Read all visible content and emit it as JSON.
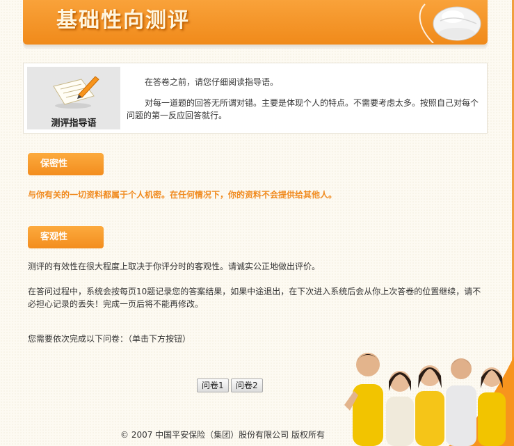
{
  "banner": {
    "title": "基础性向测评"
  },
  "guide": {
    "thumb_label": "测评指导语",
    "p1": "在答卷之前，请您仔细阅读指导语。",
    "p2": "对每一道题的回答无所谓对错。主要是体现个人的特点。不需要考虑太多。按照自己对每个问题的第一反应回答就行。"
  },
  "confidentiality": {
    "title": "保密性",
    "text": "与你有关的一切资料都属于个人机密。在任何情况下，你的资料不会提供给其他人。"
  },
  "objectivity": {
    "title": "客观性",
    "text1": "测评的有效性在很大程度上取决于你评分时的客观性。请诚实公正地做出评价。",
    "text2": "在答问过程中，系统会按每页10题记录您的答案结果，如果中途退出，在下次进入系统后会从你上次答卷的位置继续，请不必担心记录的丢失！完成一页后将不能再修改。",
    "text3": "您需要依次完成以下问卷：（单击下方按钮）"
  },
  "buttons": {
    "survey1": "问卷1",
    "survey2": "问卷2"
  },
  "footer": {
    "copyright": "© 2007 中国平安保险（集团）股份有限公司 版权所有"
  },
  "colors": {
    "accent": "#f7941d",
    "orange_text": "#f08a1e"
  }
}
